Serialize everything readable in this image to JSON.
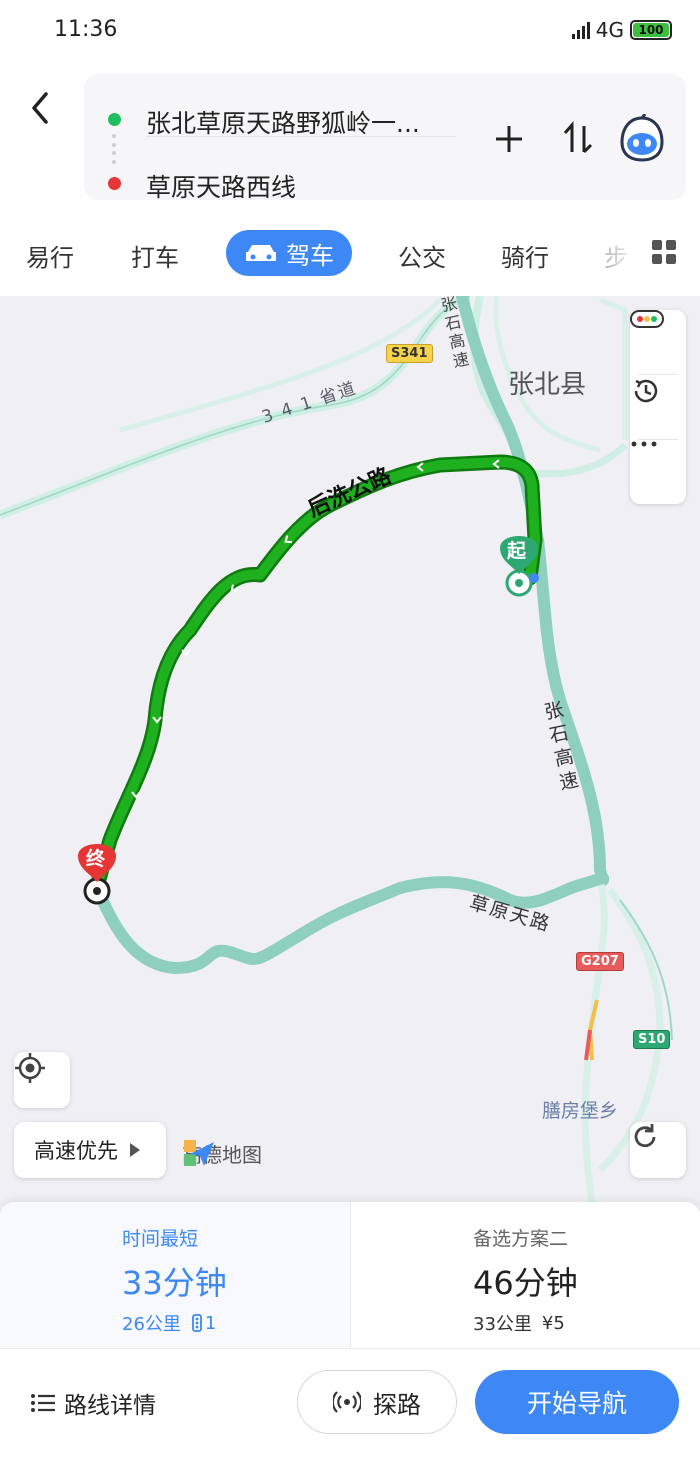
{
  "status_bar": {
    "time": "11:36",
    "network": "4G",
    "battery": "100"
  },
  "route": {
    "origin": "张北草原天路野狐岭一...",
    "destination": "草原天路西线"
  },
  "tabs": {
    "t1": "易行",
    "t2": "打车",
    "active": "驾车",
    "t4": "公交",
    "t5": "骑行",
    "t6": "步"
  },
  "map": {
    "county": "张北县",
    "road_341": "3 4 1 省道",
    "road_houxi": "后洗公路",
    "road_zhangshi_top": "张石高速",
    "road_zhangshi": "张石高速",
    "road_caoyuan": "草原天路",
    "township": "膳房堡乡",
    "shield_s341": "S341",
    "shield_g207": "G207",
    "shield_s10": "S10",
    "start_marker": "起",
    "end_marker": "终",
    "route_preference": "高速优先",
    "logo_text": "高德地图"
  },
  "options": [
    {
      "label": "时间最短",
      "duration": "33分钟",
      "distance": "26公里",
      "lights": "1"
    },
    {
      "label": "备选方案二",
      "duration": "46分钟",
      "distance": "33公里",
      "toll": "¥5"
    }
  ],
  "actions": {
    "details": "路线详情",
    "probe": "探路",
    "navigate": "开始导航"
  },
  "colors": {
    "accent": "#3d88f5",
    "route_active": "#1faa1f",
    "route_alt": "#8fcfbf",
    "start": "#2ea872",
    "end": "#e63535"
  }
}
